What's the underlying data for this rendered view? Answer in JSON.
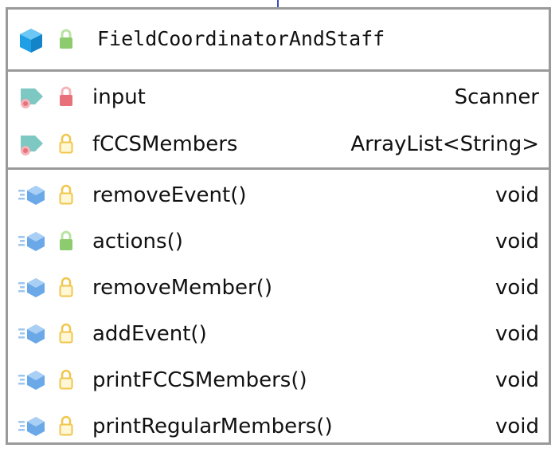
{
  "class": {
    "name": "FieldCoordinatorAndStaff"
  },
  "colors": {
    "border": "#9a9a9a",
    "connector": "#3b4cc0",
    "class_icon": "#1fa0e6",
    "field_tag": "#7ec8c3",
    "method_icon": "#6aa8e8",
    "lock_private": "#e8707a",
    "lock_package": "#f2c64a",
    "lock_public": "#8ccc6e"
  },
  "fields": [
    {
      "name": "input",
      "type": "Scanner",
      "kind_icon": "field-icon",
      "visibility": "private",
      "visibility_icon": "lock-red-icon"
    },
    {
      "name": "fCCSMembers",
      "type": "ArrayList<String>",
      "kind_icon": "field-icon",
      "visibility": "package",
      "visibility_icon": "lock-yellow-icon"
    }
  ],
  "methods": [
    {
      "name": "removeEvent()",
      "type": "void",
      "kind_icon": "method-icon",
      "visibility": "package",
      "visibility_icon": "lock-yellow-icon"
    },
    {
      "name": "actions()",
      "type": "void",
      "kind_icon": "method-icon",
      "visibility": "public",
      "visibility_icon": "lock-green-icon"
    },
    {
      "name": "removeMember()",
      "type": "void",
      "kind_icon": "method-icon",
      "visibility": "package",
      "visibility_icon": "lock-yellow-icon"
    },
    {
      "name": "addEvent()",
      "type": "void",
      "kind_icon": "method-icon",
      "visibility": "package",
      "visibility_icon": "lock-yellow-icon"
    },
    {
      "name": "printFCCSMembers()",
      "type": "void",
      "kind_icon": "method-icon",
      "visibility": "package",
      "visibility_icon": "lock-yellow-icon"
    },
    {
      "name": "printRegularMembers()",
      "type": "void",
      "kind_icon": "method-icon",
      "visibility": "package",
      "visibility_icon": "lock-yellow-icon"
    }
  ]
}
